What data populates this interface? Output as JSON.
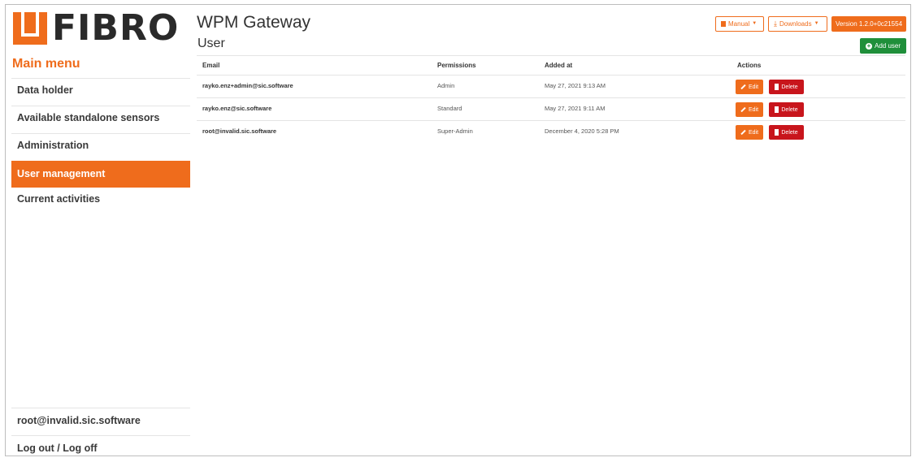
{
  "brand": {
    "logo_text": "FIBRO",
    "accent_color": "#ef6c1c",
    "success_color": "#1f8f3a",
    "danger_color": "#c8151c"
  },
  "header": {
    "app_title": "WPM Gateway",
    "page_title": "User",
    "manual_label": "Manual",
    "downloads_label": "Downloads",
    "version_label": "Version 1.2.0+0c21554",
    "add_user_label": "Add user"
  },
  "sidebar": {
    "title": "Main menu",
    "items": [
      {
        "label": "Data holder",
        "active": false
      },
      {
        "label": "Available standalone sensors",
        "active": false
      },
      {
        "label": "Administration",
        "active": false
      },
      {
        "label": "User management",
        "active": true
      },
      {
        "label": "Current activities",
        "active": false
      }
    ],
    "user_email": "root@invalid.sic.software",
    "logout_label": "Log out / Log off"
  },
  "table": {
    "columns": [
      "Email",
      "Permissions",
      "Added at",
      "Actions"
    ],
    "rows": [
      {
        "email": "rayko.enz+admin@sic.software",
        "permissions": "Admin",
        "added_at": "May 27, 2021 9:13 AM"
      },
      {
        "email": "rayko.enz@sic.software",
        "permissions": "Standard",
        "added_at": "May 27, 2021 9:11 AM"
      },
      {
        "email": "root@invalid.sic.software",
        "permissions": "Super-Admin",
        "added_at": "December 4, 2020 5:28 PM"
      }
    ],
    "edit_label": "Edit",
    "delete_label": "Delete"
  }
}
